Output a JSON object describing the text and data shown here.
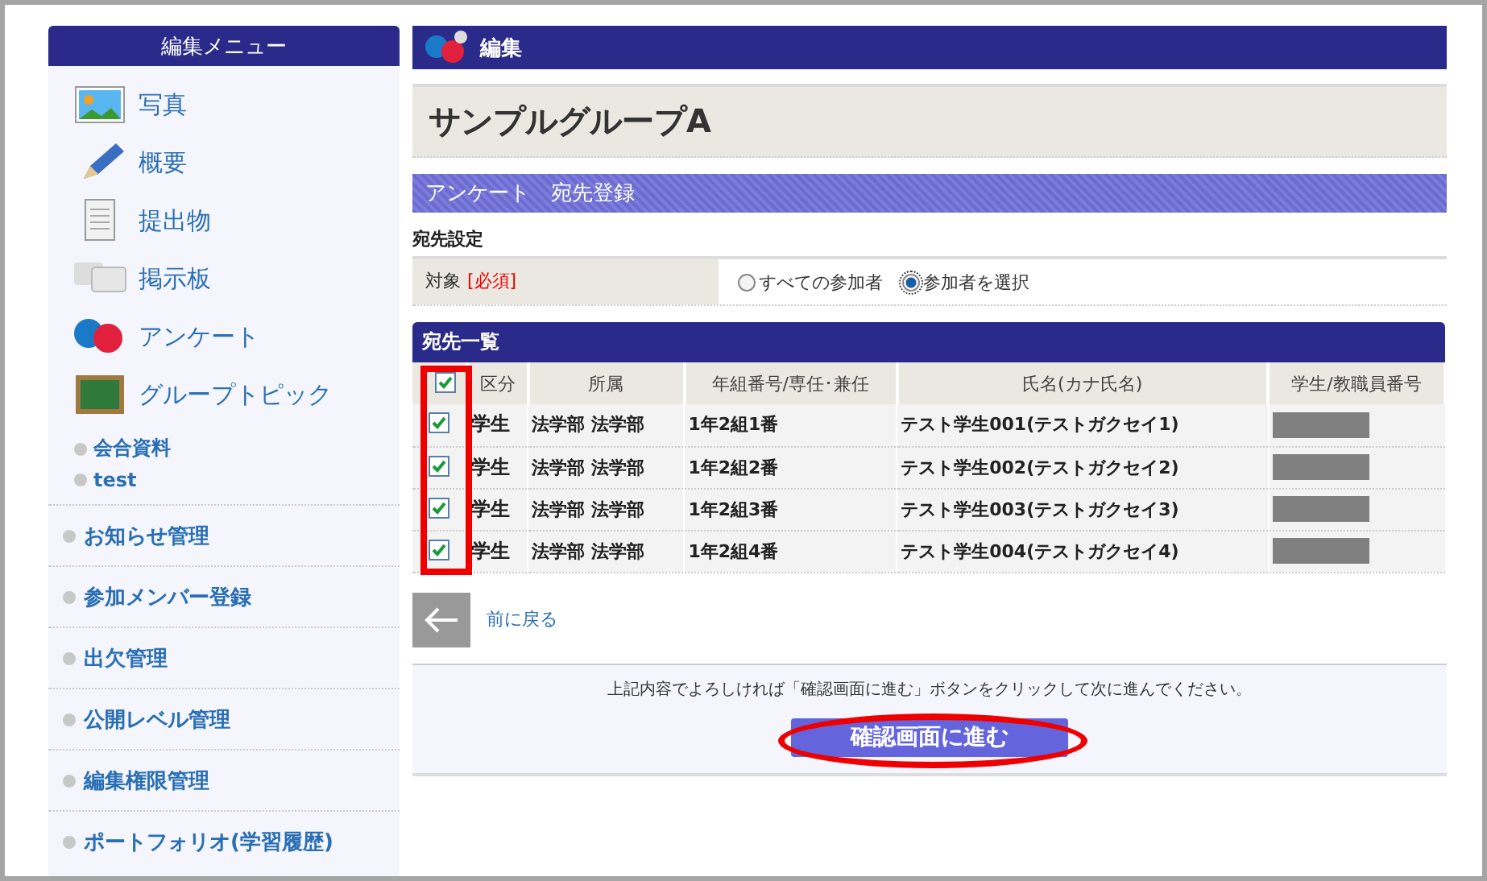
{
  "sidebar": {
    "title": "編集メニュー",
    "icon_items": [
      {
        "kind": "photo",
        "label": "写真"
      },
      {
        "kind": "pencil",
        "label": "概要"
      },
      {
        "kind": "document",
        "label": "提出物"
      },
      {
        "kind": "bubbles",
        "label": "掲示板"
      },
      {
        "kind": "qa",
        "label": "アンケート"
      },
      {
        "kind": "board",
        "label": "グループトピック"
      }
    ],
    "sub_items": [
      "会合資料",
      "test"
    ],
    "menu_items": [
      "お知らせ管理",
      "参加メンバー登録",
      "出欠管理",
      "公開レベル管理",
      "編集権限管理",
      "ポートフォリオ(学習履歴)"
    ]
  },
  "header": {
    "title": "編集"
  },
  "group_title": "サンプルグループA",
  "section_title": "アンケート　宛先登録",
  "settings": {
    "heading": "宛先設定",
    "label": "対象",
    "required": "[必須]",
    "options": [
      {
        "label": "すべての参加者",
        "selected": false
      },
      {
        "label": "参加者を選択",
        "selected": true
      }
    ]
  },
  "table": {
    "title": "宛先一覧",
    "all_checked": true,
    "columns": [
      "区分",
      "所属",
      "年組番号/専任･兼任",
      "氏名(カナ氏名)",
      "学生/教職員番号"
    ],
    "rows": [
      {
        "checked": true,
        "cells": [
          "学生",
          "法学部 法学部",
          "1年2組1番",
          "テスト学生001(テストガクセイ1)"
        ]
      },
      {
        "checked": true,
        "cells": [
          "学生",
          "法学部 法学部",
          "1年2組2番",
          "テスト学生002(テストガクセイ2)"
        ]
      },
      {
        "checked": true,
        "cells": [
          "学生",
          "法学部 法学部",
          "1年2組3番",
          "テスト学生003(テストガクセイ3)"
        ]
      },
      {
        "checked": true,
        "cells": [
          "学生",
          "法学部 法学部",
          "1年2組4番",
          "テスト学生004(テストガクセイ4)"
        ]
      }
    ]
  },
  "back_link": "前に戻る",
  "footer": {
    "message": "上記内容でよろしければ「確認画面に進む」ボタンをクリックして次に進んでください。",
    "button": "確認画面に進む"
  }
}
